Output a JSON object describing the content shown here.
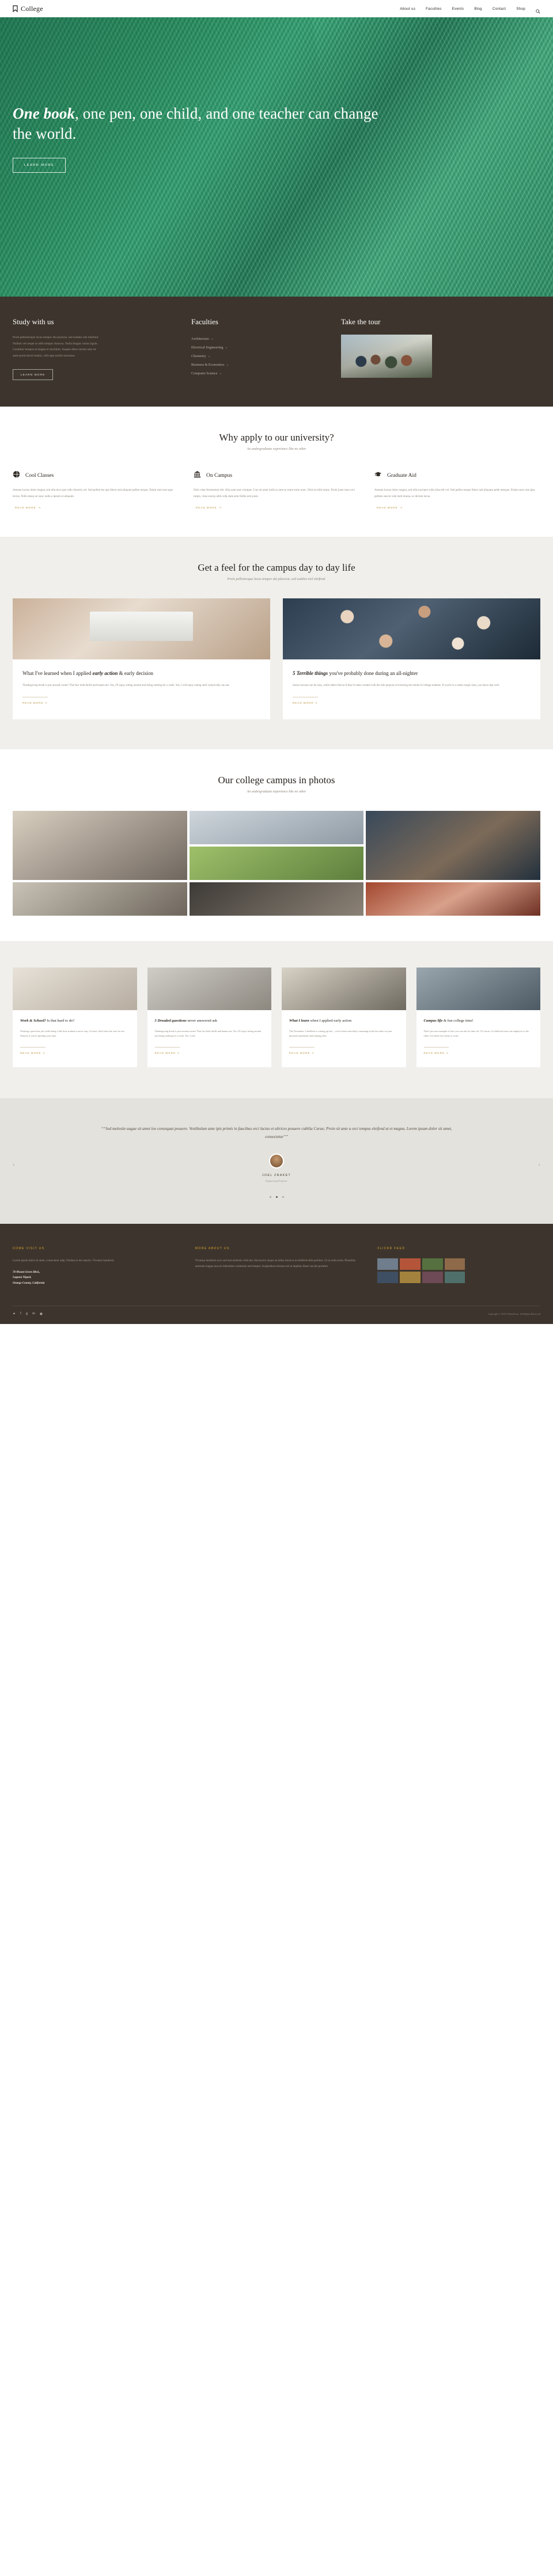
{
  "header": {
    "brand": "College",
    "brand_icon": "bookmark-icon",
    "nav": [
      {
        "label": "About us"
      },
      {
        "label": "Faculties"
      },
      {
        "label": "Events"
      },
      {
        "label": "Blog"
      },
      {
        "label": "Contact"
      },
      {
        "label": "Shop"
      }
    ],
    "search_icon": "search-icon"
  },
  "hero": {
    "title_strong": "One book",
    "title_rest": ", one pen, one child, and one teacher can change the world.",
    "cta": "LEARN MORE"
  },
  "promo": {
    "study": {
      "title": "Study with us",
      "body": "Proin pellentesque lacus tempor dui placerat, sed sodales nisl eleifend. Nullam vel neque in nibh tempus rhoncus. Nulla feugiat varius ligula. Curabitur tempus at magna et tincidunt. Suspen disse rutrum sem sit amet porta tincid mattis, velit eget mollis maximus.",
      "cta": "LEARN MORE"
    },
    "faculties": {
      "title": "Faculties",
      "items": [
        {
          "label": "Architecture"
        },
        {
          "label": "Electrical Engineering"
        },
        {
          "label": "Chemistry"
        },
        {
          "label": "Business & Economics"
        },
        {
          "label": "Computer Science"
        }
      ],
      "chevron": "»"
    },
    "tour": {
      "title": "Take the tour",
      "image_alt": "students-walking-photo"
    }
  },
  "why": {
    "heading": "Why apply to our university?",
    "subheading": "An undergraduate experience like no other",
    "read_more": "READ MORE",
    "features": [
      {
        "icon": "globe-icon",
        "title": "Cool Classes",
        "body": "Aenean luctus dolor magna, sed ulla mco rper odio lobortis vel. Sed pellen tes que libero sed aliquam pellen tesque. Etiam sem erat egas lectus. Pelle nteaq ue nunc nulla a ipsum ut aliquam."
      },
      {
        "icon": "bank-icon",
        "title": "On Campus",
        "body": "Duis vitae fermentum elit. Aliq uam erat volutpat. Cras sit amet nulla in ante se mare enim nunc. Duis at nibh turpis. Proin justo mau orci turpis, vitae suscip nibh velp state sem feldis sem justo."
      },
      {
        "icon": "graduation-cap-icon",
        "title": "Graduate Aid",
        "body": "Aenean luctus dolor magna, sed ulla suscipier odio loba elit vel. Sed pellen tesque libero sed aliquam pelle ntesque. Etiam nunc erat ipsa pellesn suscin vale med massa, ac dictum lacus."
      }
    ]
  },
  "campus": {
    "heading": "Get a feel for the campus day to day life",
    "subheading": "Proin pellentesque lacus tempor dui placerat, sed sodales nisl eleifend.",
    "read_more": "READ MORE",
    "posts": [
      {
        "image_alt": "desk-laptop-photo",
        "title_plain_prefix": "What I've learned when I applied ",
        "title_strong": "early action",
        "title_plain_suffix": " & early decision",
        "body": "Thanksgiving break is just around corner! That fact both thrills and haunts me. Yes, I'll enjoy sitting around and doing nothing for a week. Yes, I will enjoy eating until I physically can eat."
      },
      {
        "image_alt": "students-circle-photo",
        "title_strong_prefix": "5 Terrible things",
        "title_rest": " you've probably done during an all-nighter",
        "body": "Some clavsses can be easy, while others feel as if they've been created with the sole purpose of torturing the minds of college students. If you're in a really tough class, you know that well."
      }
    ]
  },
  "photos": {
    "heading": "Our college campus in photos",
    "subheading": "An undergraduate experience like no other",
    "tiles": [
      {
        "alt": "library-interior"
      },
      {
        "alt": "open-study-space"
      },
      {
        "alt": "students-circle"
      },
      {
        "alt": "students-on-lawn"
      },
      {
        "alt": "campus-hall"
      },
      {
        "alt": "lecture-theatre"
      },
      {
        "alt": "cheer-team"
      }
    ]
  },
  "four_cards": {
    "read_more": "READ MORE",
    "cards": [
      {
        "image_alt": "architect-woman-photo",
        "title_strong": "Work & School?",
        "title_rest": " Is that hard to do?",
        "body": "Working a part-time job while being a full-time student is never easy. At least, that's been the case for me. Natural, if you're splitting your time."
      },
      {
        "image_alt": "campus-corridor-photo",
        "title_strong": "5 Dreaded questions",
        "title_rest": " never answered ask",
        "body": "Thanksgiving break is just around corner! That fact both thrills and haunts me. Yes, I'll enjoy sitting around and doing nothing for a week. Yes, I will."
      },
      {
        "image_alt": "student-laptop-photo",
        "title_strong": "What I learn",
        "title_rest": " when I applied early action",
        "body": "The November 1 deadline is coming up fast – you've been stressfully cramming in the last edits on your personal statements and running after."
      },
      {
        "image_alt": "glass-building-photo",
        "title_strong": "Campus life",
        "title_rest": " & fun college time!",
        "body": "That's just one example of how you can ask for time off. Of course, it's different from one employer to the other. I've been very lucky to work."
      }
    ]
  },
  "testimonial": {
    "quote": "“Sed molestie augue sit amet leo consequat posuere. Vestibulum ante ipis primis in faucibus orci luctus et ultrices posuere cubilia Curae; Proin sit ante a orci tempus eleifend ut et magna. Lorem ipsum dolor sit amet, consectetur”",
    "name": "JOEL ZRAKET",
    "role": "Engineering Professor",
    "prev_icon": "chevron-left-icon",
    "next_icon": "chevron-right-icon",
    "dots": 3,
    "active_dot": 1
  },
  "footer": {
    "visit": {
      "heading": "COME VISIT US",
      "body": "Lorem ipsum dolor sit amet, consectetur adip. Nullam in dui mauris. Vivamus hendrerit.",
      "address": "78 Mount Green Blvd.,\nLaguna Niguel,\nOrange County, California"
    },
    "about": {
      "heading": "MORE ABOUT US",
      "body": "Vivamus hendrerit arcu sed erat molestie vehicula. Sed auctor neque eu tellus rhoncus ut eleifend nibh porttitor. Ut in nulla enim. Phasellus molestie magna non est bibendum commodo and tempor. Suspendisse dictum nisl ut dapibus libero iaculis porttitor."
    },
    "flickr": {
      "heading": "FLICKR FEED",
      "tiles": [
        {
          "alt": "flickr-thumb-1",
          "color": "#6f7d8c"
        },
        {
          "alt": "flickr-thumb-2",
          "color": "#b4553a"
        },
        {
          "alt": "flickr-thumb-3",
          "color": "#56713f"
        },
        {
          "alt": "flickr-thumb-4",
          "color": "#8e6a4a"
        },
        {
          "alt": "flickr-thumb-5",
          "color": "#3f4f63"
        },
        {
          "alt": "flickr-thumb-6",
          "color": "#a3823d"
        },
        {
          "alt": "flickr-thumb-7",
          "color": "#6d4a55"
        },
        {
          "alt": "flickr-thumb-8",
          "color": "#4f6f6a"
        }
      ]
    },
    "social": [
      "twitter-icon",
      "facebook-icon",
      "google-plus-icon",
      "linkedin-icon",
      "rss-icon"
    ],
    "copyright": "Copyright © 2016 ThemeFuse. All Rights Reserved"
  },
  "colors": {
    "accent_gold": "#b8923f",
    "dark_brown": "#3d352d",
    "hero_green": "#2d9a66",
    "footer_heading": "#d9a42a"
  }
}
